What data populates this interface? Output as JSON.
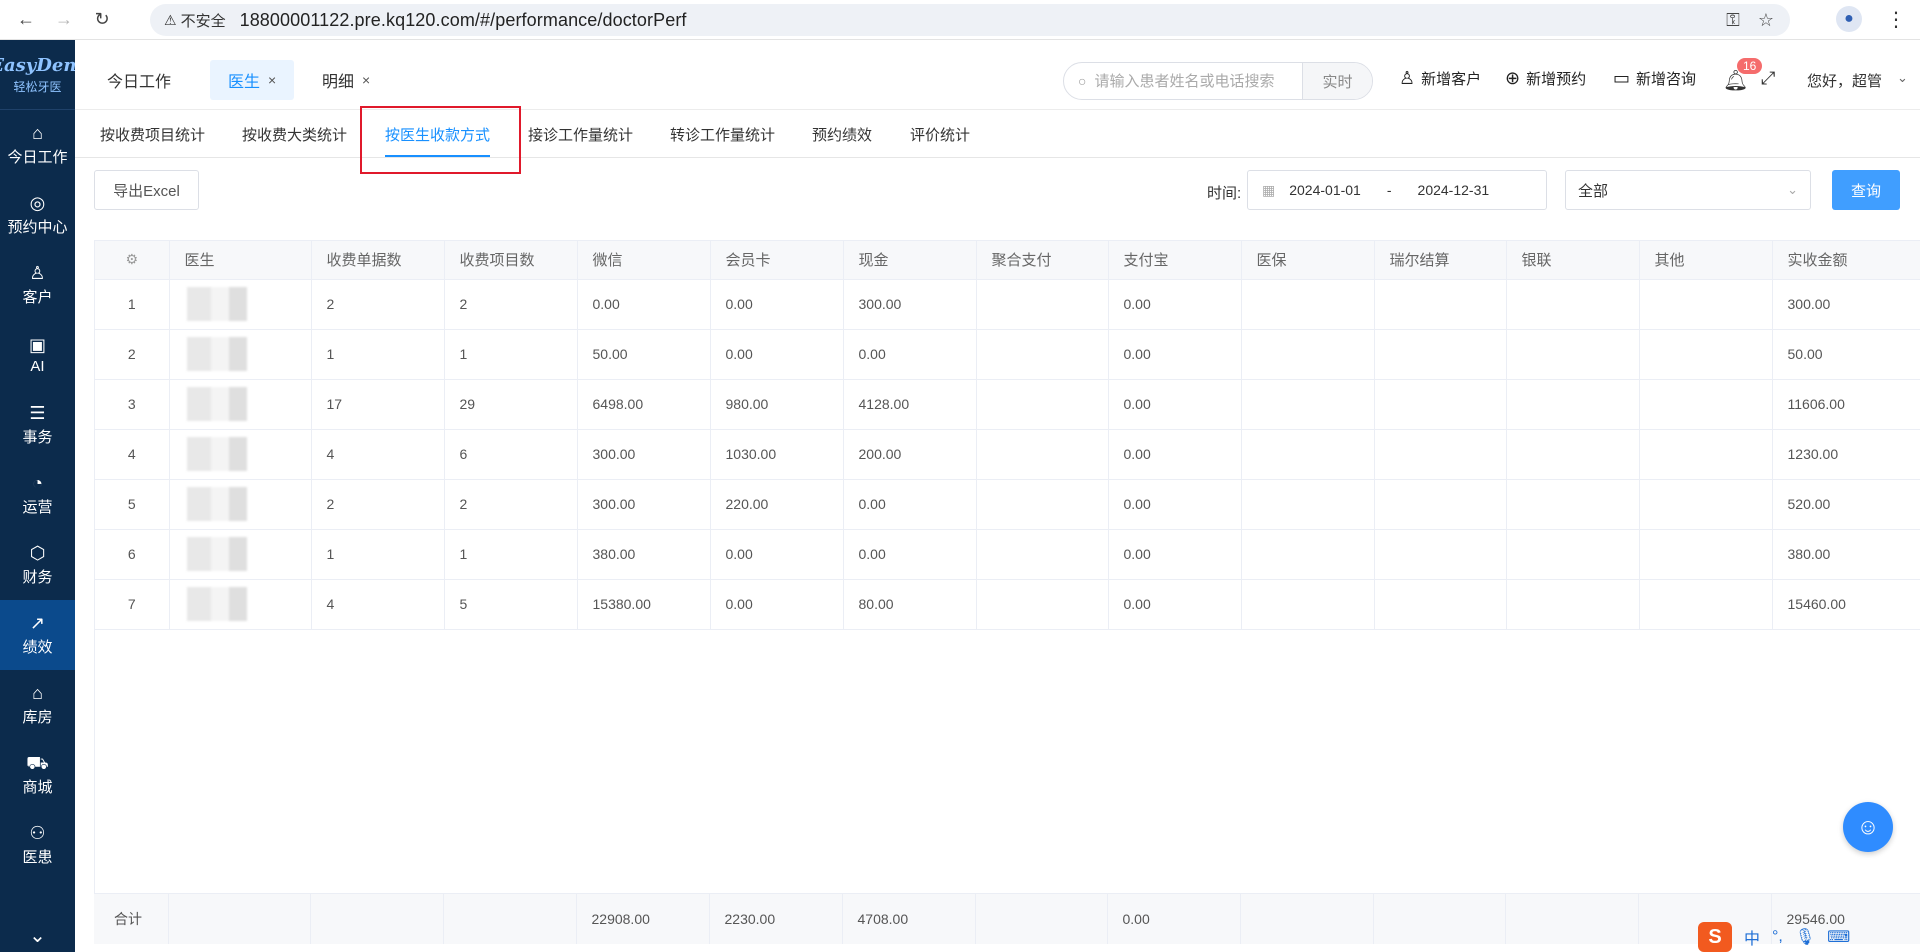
{
  "browser": {
    "insecure_label": "不安全",
    "url": "18800001122.pre.kq120.com/#/performance/doctorPerf",
    "back_icon": "arrow-left-icon",
    "forward_icon": "arrow-right-icon",
    "reload_icon": "reload-icon"
  },
  "sidebar": {
    "logo_en": "EasyDent",
    "logo_cn": "轻松牙医",
    "items": [
      {
        "label": "今日工作",
        "icon": "⌂"
      },
      {
        "label": "预约中心",
        "icon": "◎"
      },
      {
        "label": "客户",
        "icon": "♙"
      },
      {
        "label": "AI",
        "icon": "▣"
      },
      {
        "label": "事务",
        "icon": "☰"
      },
      {
        "label": "运营",
        "icon": "◔"
      },
      {
        "label": "财务",
        "icon": "⬡"
      },
      {
        "label": "绩效",
        "icon": "↗"
      },
      {
        "label": "库房",
        "icon": "⌂"
      },
      {
        "label": "商城",
        "icon": "⛟"
      },
      {
        "label": "医患",
        "icon": "⚇"
      }
    ]
  },
  "header": {
    "tabs": [
      {
        "label": "今日工作"
      },
      {
        "label": "医生"
      },
      {
        "label": "明细"
      }
    ],
    "search_placeholder": "请输入患者姓名或电话搜索",
    "search_mode": "实时",
    "actions": [
      {
        "label": "新增客户"
      },
      {
        "label": "新增预约"
      },
      {
        "label": "新增咨询"
      }
    ],
    "notification_count": "16",
    "greeting": "您好，超管"
  },
  "sub_tabs": [
    {
      "label": "按收费项目统计"
    },
    {
      "label": "按收费大类统计"
    },
    {
      "label": "按医生收款方式"
    },
    {
      "label": "接诊工作量统计"
    },
    {
      "label": "转诊工作量统计"
    },
    {
      "label": "预约绩效"
    },
    {
      "label": "评价统计"
    }
  ],
  "toolbar": {
    "export_label": "导出Excel",
    "time_label": "时间:",
    "date_start": "2024-01-01",
    "date_sep": "-",
    "date_end": "2024-12-31",
    "filter_value": "全部",
    "query_label": "查询"
  },
  "table": {
    "columns": [
      "医生",
      "收费单据数",
      "收费项目数",
      "微信",
      "会员卡",
      "现金",
      "聚合支付",
      "支付宝",
      "医保",
      "瑞尔结算",
      "银联",
      "其他",
      "实收金额"
    ],
    "rows": [
      [
        "1",
        "",
        "2",
        "2",
        "0.00",
        "0.00",
        "300.00",
        "",
        "0.00",
        "",
        "",
        "",
        "",
        "300.00"
      ],
      [
        "2",
        "",
        "1",
        "1",
        "50.00",
        "0.00",
        "0.00",
        "",
        "0.00",
        "",
        "",
        "",
        "",
        "50.00"
      ],
      [
        "3",
        "",
        "17",
        "29",
        "6498.00",
        "980.00",
        "4128.00",
        "",
        "0.00",
        "",
        "",
        "",
        "",
        "11606.00"
      ],
      [
        "4",
        "",
        "4",
        "6",
        "300.00",
        "1030.00",
        "200.00",
        "",
        "0.00",
        "",
        "",
        "",
        "",
        "1230.00"
      ],
      [
        "5",
        "",
        "2",
        "2",
        "300.00",
        "220.00",
        "0.00",
        "",
        "0.00",
        "",
        "",
        "",
        "",
        "520.00"
      ],
      [
        "6",
        "",
        "1",
        "1",
        "380.00",
        "0.00",
        "0.00",
        "",
        "0.00",
        "",
        "",
        "",
        "",
        "380.00"
      ],
      [
        "7",
        "",
        "4",
        "5",
        "15380.00",
        "0.00",
        "80.00",
        "",
        "0.00",
        "",
        "",
        "",
        "",
        "15460.00"
      ]
    ],
    "totals": [
      "合计",
      "",
      "",
      "",
      "22908.00",
      "2230.00",
      "4708.00",
      "",
      "0.00",
      "",
      "",
      "",
      "",
      "29546.00"
    ]
  },
  "ime": {
    "lang": "中",
    "punct": "°,"
  }
}
